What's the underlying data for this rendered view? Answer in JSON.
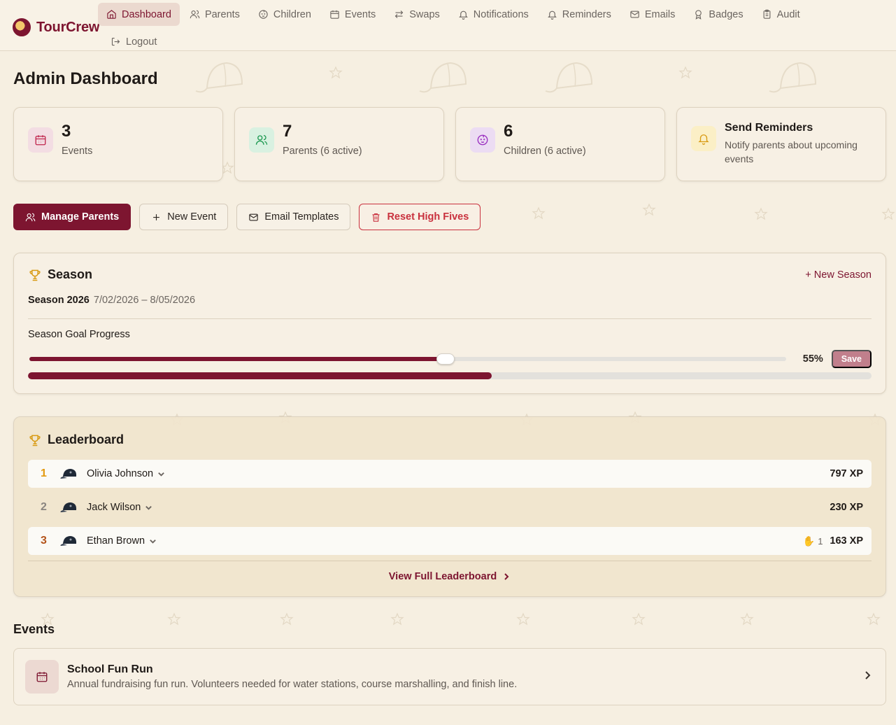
{
  "brand": {
    "name": "TourCrew"
  },
  "nav": {
    "items": [
      {
        "label": "Dashboard",
        "icon": "home-icon",
        "active": true
      },
      {
        "label": "Parents",
        "icon": "users-icon"
      },
      {
        "label": "Children",
        "icon": "baby-icon"
      },
      {
        "label": "Events",
        "icon": "calendar-icon"
      },
      {
        "label": "Swaps",
        "icon": "swap-icon"
      },
      {
        "label": "Notifications",
        "icon": "bell-icon"
      },
      {
        "label": "Reminders",
        "icon": "bell-icon"
      },
      {
        "label": "Emails",
        "icon": "mail-icon"
      },
      {
        "label": "Badges",
        "icon": "award-icon"
      },
      {
        "label": "Audit",
        "icon": "clipboard-icon"
      }
    ],
    "logout": "Logout"
  },
  "page": {
    "title": "Admin Dashboard"
  },
  "stats": {
    "events": {
      "count": "3",
      "label": "Events"
    },
    "parents": {
      "count": "7",
      "label": "Parents (6 active)"
    },
    "children": {
      "count": "6",
      "label": "Children (6 active)"
    },
    "reminders": {
      "title": "Send Reminders",
      "desc": "Notify parents about upcoming events"
    }
  },
  "actions": {
    "manage_parents": "Manage Parents",
    "new_event": "New Event",
    "email_templates": "Email Templates",
    "reset_high_fives": "Reset High Fives"
  },
  "season": {
    "title": "Season",
    "new_season": "+ New Season",
    "name": "Season 2026",
    "dates": "7/02/2026 – 8/05/2026",
    "goal_label": "Season Goal Progress",
    "slider_value": 0.55,
    "percent_text": "55%",
    "save": "Save",
    "progress_value": 0.55
  },
  "leaderboard": {
    "title": "Leaderboard",
    "rows": [
      {
        "rank": "1",
        "name": "Olivia Johnson",
        "xp": "797 XP",
        "high_fives": "",
        "rank_color": "#e39a10"
      },
      {
        "rank": "2",
        "name": "Jack Wilson",
        "xp": "230 XP",
        "high_fives": "",
        "rank_color": "#8a8580"
      },
      {
        "rank": "3",
        "name": "Ethan Brown",
        "xp": "163 XP",
        "high_fives": "1",
        "rank_color": "#b4541b"
      }
    ],
    "view_full": "View Full Leaderboard"
  },
  "events": {
    "title": "Events",
    "items": [
      {
        "name": "School Fun Run",
        "desc": "Annual fundraising fun run. Volunteers needed for water stations, course marshalling, and finish line."
      }
    ]
  },
  "colors": {
    "brand": "#7d1530",
    "gold": "#d89a12",
    "danger": "#c9313e",
    "background": "#f6efe1"
  }
}
